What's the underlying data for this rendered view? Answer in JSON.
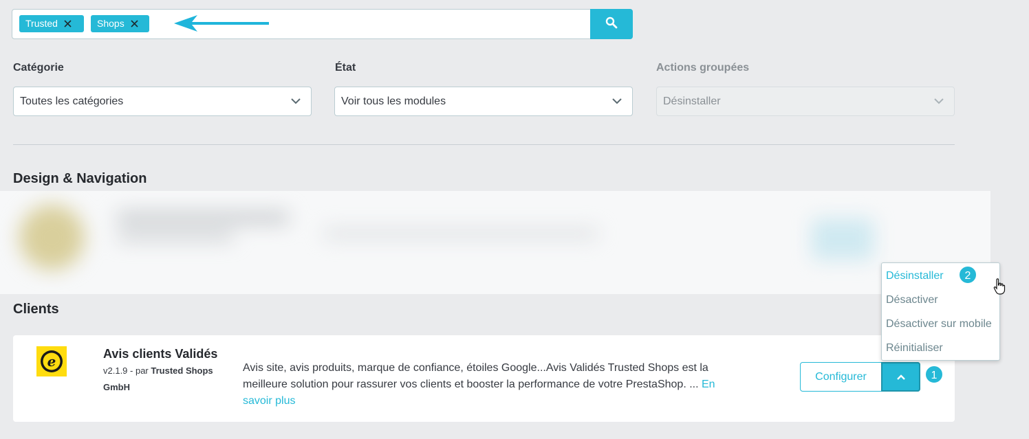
{
  "search": {
    "tags": [
      {
        "label": "Trusted"
      },
      {
        "label": "Shops"
      }
    ]
  },
  "filters": {
    "category": {
      "label": "Catégorie",
      "value": "Toutes les catégories"
    },
    "state": {
      "label": "État",
      "value": "Voir tous les modules"
    },
    "bulk": {
      "label": "Actions groupées",
      "value": "Désinstaller"
    }
  },
  "sections": {
    "design": "Design & Navigation",
    "clients": "Clients"
  },
  "module": {
    "name": "Avis clients Validés",
    "version": "v2.1.9 - par ",
    "author": "Trusted Shops GmbH",
    "description": "Avis site, avis produits, marque de confiance, étoiles Google...Avis Validés Trusted Shops est la meilleure solution pour rassurer vos clients et booster la performance de votre PrestaShop. ... ",
    "more_link": "En savoir plus",
    "configure_label": "Configurer"
  },
  "menu": {
    "items": [
      {
        "label": "Désinstaller"
      },
      {
        "label": "Désactiver"
      },
      {
        "label": "Désactiver sur mobile"
      },
      {
        "label": "Réinitialiser"
      }
    ]
  },
  "annotations": {
    "badge_1": "1",
    "badge_2": "2"
  },
  "colors": {
    "accent": "#25b9d7",
    "background": "#eaebed",
    "text": "#363a41"
  },
  "icons": {
    "search": "search-icon",
    "tag_remove": "close-icon",
    "select": "chevron-down-icon",
    "toggle": "chevron-up-icon",
    "cursor": "hand-pointer-icon",
    "annotation": "arrow-left-icon"
  }
}
